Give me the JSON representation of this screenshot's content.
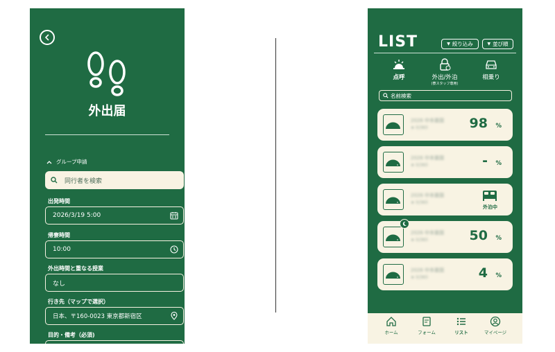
{
  "left": {
    "title": "外出届",
    "group_label": "グループ申請",
    "search_placeholder": "同行者を検索",
    "fields": [
      {
        "label": "出発時間",
        "value": "2026/3/19 5:00",
        "icon": "calendar-icon"
      },
      {
        "label": "帰寮時間",
        "value": "10:00",
        "icon": "clock-icon"
      },
      {
        "label": "外出時間と重なる授業",
        "value": "なし",
        "icon": ""
      },
      {
        "label": "行き先（マップで選択）",
        "value": "日本、〒160-0023 東京都新宿区",
        "icon": "location-pin-icon"
      },
      {
        "label": "目的・備考（必須)",
        "value": "",
        "icon": ""
      }
    ],
    "colors": {
      "primary": "#1f6b43",
      "cream": "#f8f3e3"
    }
  },
  "right": {
    "title": "LIST",
    "filter_button": "絞り込み",
    "sort_button": "並び順",
    "tabs": [
      {
        "label": "点呼",
        "sub": "",
        "icon": "roll-call-bell-icon"
      },
      {
        "label": "外出/外泊",
        "sub": "(寮スタッフ専用)",
        "icon": "lock-person-icon"
      },
      {
        "label": "相乗り",
        "sub": "",
        "icon": "car-icon"
      }
    ],
    "name_search_placeholder": "名前検索",
    "cards": [
      {
        "name": "2026 中本塁国",
        "sub": "★ 0/3K0",
        "value": "98",
        "unit": "%",
        "status": "",
        "badge": ""
      },
      {
        "name": "2026 中本塁国",
        "sub": "★ 0/3K0",
        "value": "-",
        "unit": "%",
        "status": "",
        "badge": ""
      },
      {
        "name": "2026 中本塁国",
        "sub": "★ 0/3K0",
        "value": "",
        "unit": "",
        "status": "外泊中",
        "badge": ""
      },
      {
        "name": "2026 中本塁国",
        "sub": "★ 0/3K0",
        "value": "50",
        "unit": "%",
        "status": "",
        "badge": "moon-icon"
      },
      {
        "name": "2026 中本塁国",
        "sub": "★ 0/3K0",
        "value": "4",
        "unit": "%",
        "status": "",
        "badge": ""
      }
    ],
    "nav": [
      {
        "label": "ホーム",
        "icon": "home-icon"
      },
      {
        "label": "フォーム",
        "icon": "form-icon"
      },
      {
        "label": "リスト",
        "icon": "list-icon"
      },
      {
        "label": "マイページ",
        "icon": "profile-icon"
      }
    ]
  }
}
